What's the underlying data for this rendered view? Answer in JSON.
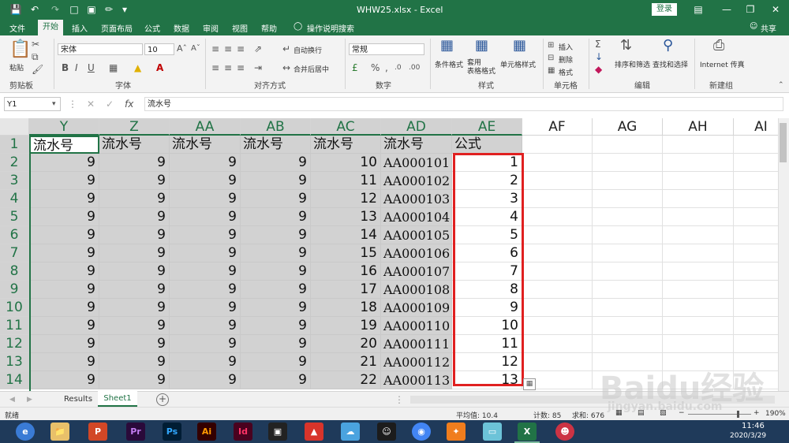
{
  "titlebar": {
    "filename": "WHW25.xlsx - Excel",
    "login": "登录"
  },
  "tabs": [
    "文件",
    "开始",
    "插入",
    "页面布局",
    "公式",
    "数据",
    "审阅",
    "视图",
    "帮助",
    "操作说明搜索"
  ],
  "share": "共享",
  "ribbon": {
    "paste": "粘贴",
    "clipboard": "剪贴板",
    "font_name": "宋体",
    "font_size": "10",
    "font_group": "字体",
    "wrap_text": "自动换行",
    "merge_center": "合并后居中",
    "align_group": "对齐方式",
    "number_format": "常规",
    "number_group": "数字",
    "cond_format": "条件格式",
    "table_format": "套用\n表格格式",
    "cell_style": "单元格样式",
    "style_group": "样式",
    "insert": "插入",
    "delete": "删除",
    "format": "格式",
    "cells_group": "单元格",
    "sort_filter": "排序和筛选",
    "find_select": "查找和选择",
    "edit_group": "编辑",
    "internet": "Internet 传真",
    "new_group": "新建组"
  },
  "formula_bar": {
    "name_box": "Y1",
    "formula": "流水号"
  },
  "columns": [
    "Y",
    "Z",
    "AA",
    "AB",
    "AC",
    "AD",
    "AE",
    "AF",
    "AG",
    "AH",
    "AI"
  ],
  "rows": [
    "1",
    "2",
    "3",
    "4",
    "5",
    "6",
    "7",
    "8",
    "9",
    "10",
    "11",
    "12",
    "13",
    "14"
  ],
  "header_row": [
    "流水号",
    "流水号",
    "流水号",
    "流水号",
    "流水号",
    "流水号",
    "公式"
  ],
  "data": [
    [
      "9",
      "9",
      "9",
      "9",
      "10",
      "AA000101",
      "1"
    ],
    [
      "9",
      "9",
      "9",
      "9",
      "11",
      "AA000102",
      "2"
    ],
    [
      "9",
      "9",
      "9",
      "9",
      "12",
      "AA000103",
      "3"
    ],
    [
      "9",
      "9",
      "9",
      "9",
      "13",
      "AA000104",
      "4"
    ],
    [
      "9",
      "9",
      "9",
      "9",
      "14",
      "AA000105",
      "5"
    ],
    [
      "9",
      "9",
      "9",
      "9",
      "15",
      "AA000106",
      "6"
    ],
    [
      "9",
      "9",
      "9",
      "9",
      "16",
      "AA000107",
      "7"
    ],
    [
      "9",
      "9",
      "9",
      "9",
      "17",
      "AA000108",
      "8"
    ],
    [
      "9",
      "9",
      "9",
      "9",
      "18",
      "AA000109",
      "9"
    ],
    [
      "9",
      "9",
      "9",
      "9",
      "19",
      "AA000110",
      "10"
    ],
    [
      "9",
      "9",
      "9",
      "9",
      "20",
      "AA000111",
      "11"
    ],
    [
      "9",
      "9",
      "9",
      "9",
      "21",
      "AA000112",
      "12"
    ],
    [
      "9",
      "9",
      "9",
      "9",
      "22",
      "AA000113",
      "13"
    ]
  ],
  "sheets": [
    "Results",
    "Sheet1"
  ],
  "status": {
    "ready": "就绪",
    "average": "平均值: 10.4",
    "count": "计数: 85",
    "sum": "求和: 676",
    "zoom": "190%"
  },
  "clock": {
    "time": "11:46",
    "date": "2020/3/29"
  },
  "watermark": "Baidu经验",
  "watermark_url": "jingyan.baidu.com",
  "colors": {
    "excel_green": "#217346",
    "highlight_red": "#e02020",
    "selection_gray": "#d2d2d2"
  }
}
